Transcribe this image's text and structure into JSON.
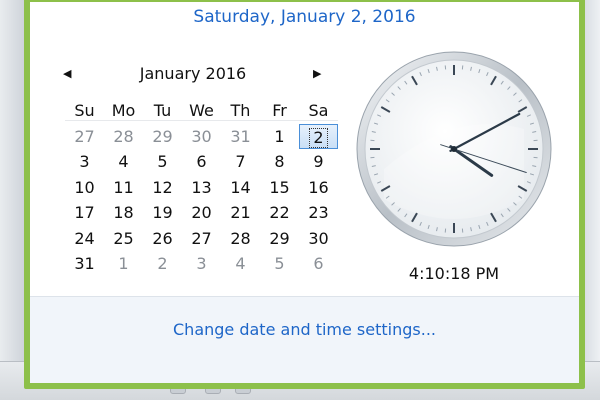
{
  "flyout": {
    "long_date": "Saturday, January 2, 2016",
    "time_text": "4:10:18 PM",
    "settings_link": "Change date and time settings...",
    "highlight_color": "#8dc04a",
    "link_color": "#1e66c8"
  },
  "calendar": {
    "month_label": "January 2016",
    "prev_icon": "triangle-left-icon",
    "next_icon": "triangle-right-icon",
    "weekdays": [
      "Su",
      "Mo",
      "Tu",
      "We",
      "Th",
      "Fr",
      "Sa"
    ],
    "weeks": [
      [
        "27",
        "28",
        "29",
        "30",
        "31",
        "1",
        "2"
      ],
      [
        "3",
        "4",
        "5",
        "6",
        "7",
        "8",
        "9"
      ],
      [
        "10",
        "11",
        "12",
        "13",
        "14",
        "15",
        "16"
      ],
      [
        "17",
        "18",
        "19",
        "20",
        "21",
        "22",
        "23"
      ],
      [
        "24",
        "25",
        "26",
        "27",
        "28",
        "29",
        "30"
      ],
      [
        "31",
        "1",
        "2",
        "3",
        "4",
        "5",
        "6"
      ]
    ],
    "selected_day": "2"
  },
  "clock": {
    "hour": 4,
    "minute": 10,
    "second": 18
  }
}
